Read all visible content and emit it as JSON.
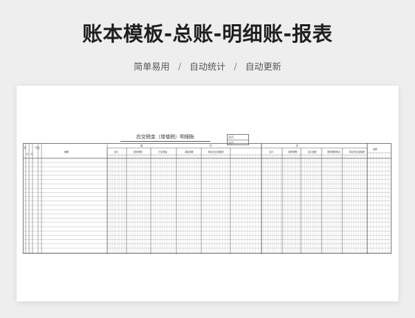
{
  "header": {
    "title": "账本模板-总账-明细账-报表",
    "tags": [
      "简单易用",
      "自动统计",
      "自动更新"
    ],
    "separator": "/"
  },
  "sheet": {
    "title": "应交税金（增值税）明细账",
    "meta_labels": [
      "总页",
      "分页"
    ],
    "col_labels": {
      "year": "年",
      "month": "月",
      "day": "日",
      "voucher": "凭证",
      "summary": "摘要",
      "debit": "借",
      "credit": "贷",
      "subtotal": "合计",
      "balance": "余额"
    },
    "debit_subheads": [
      "合计",
      "进项税额",
      "已交税金",
      "减免税款",
      "转出未交增值税"
    ],
    "credit_subheads": [
      "合计",
      "销项税额",
      "出口退税",
      "进项税额转出",
      "转出多交增值税"
    ]
  },
  "colors": {
    "background": "#eeeeee",
    "card": "#ffffff",
    "grid_line": "#555555",
    "fine_line": "#b8b8b8"
  }
}
